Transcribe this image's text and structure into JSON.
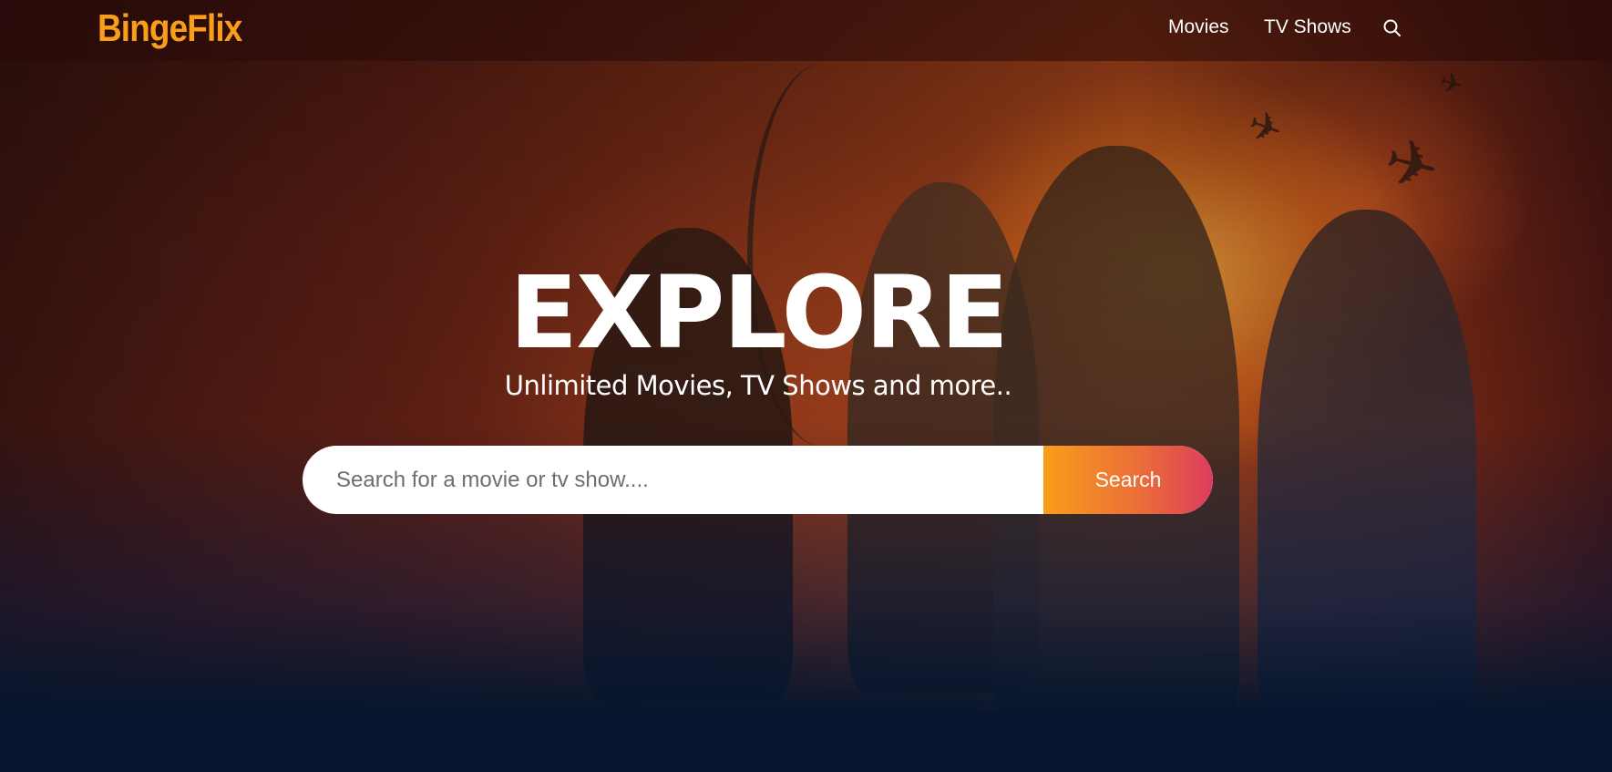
{
  "header": {
    "logo": "BingeFlix",
    "nav": [
      {
        "label": "Movies"
      },
      {
        "label": "TV Shows"
      }
    ],
    "search_icon": "search-icon"
  },
  "hero": {
    "title": "EXPLORE",
    "subtitle": "Unlimited Movies, TV Shows and more..",
    "search": {
      "placeholder": "Search for a movie or tv show....",
      "value": "",
      "button_label": "Search"
    }
  },
  "colors": {
    "brand": "#f89e1b",
    "button_gradient_start": "#f89e1b",
    "button_gradient_end": "#dd3c5e",
    "page_background": "#04152d",
    "text": "#ffffff"
  }
}
